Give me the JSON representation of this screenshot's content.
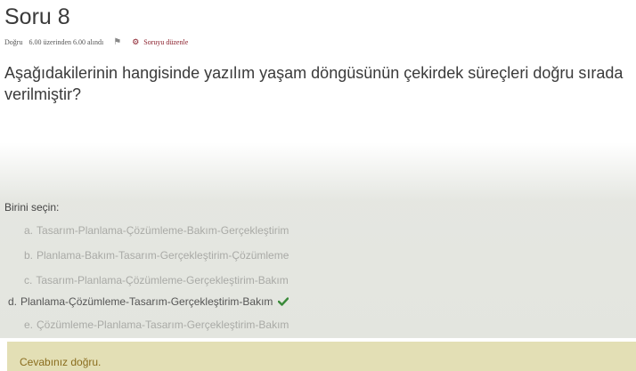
{
  "question": {
    "title": "Soru 8",
    "status": "Doğru",
    "grade": "6.00 üzerinden 6.00 alındı",
    "flag_icon": "flag-icon",
    "gear_icon": "gear-icon",
    "edit_link": "Soruyu düzenle",
    "text": "Aşağıdakilerinin hangisinde yazılım yaşam döngüsünün çekirdek süreçleri doğru sırada verilmiştir?"
  },
  "answers": {
    "prompt": "Birini seçin:",
    "options": [
      {
        "letter": "a.",
        "text": "Tasarım-Planlama-Çözümleme-Bakım-Gerçekleştirim"
      },
      {
        "letter": "b.",
        "text": "Planlama-Bakım-Tasarım-Gerçekleştirim-Çözümleme"
      },
      {
        "letter": "c.",
        "text": "Tasarım-Planlama-Çözümleme-Gerçekleştirim-Bakım"
      },
      {
        "letter": "d.",
        "text": "Planlama-Çözümleme-Tasarım-Gerçekleştirim-Bakım"
      },
      {
        "letter": "e.",
        "text": "Çözümleme-Planlama-Tasarım-Gerçekleştirim-Bakım"
      }
    ],
    "correct_icon": "check-icon",
    "correct_color": "#3a8a3a"
  },
  "feedback": {
    "text": "Cevabınız doğru.",
    "background": "#e3dfb5"
  }
}
